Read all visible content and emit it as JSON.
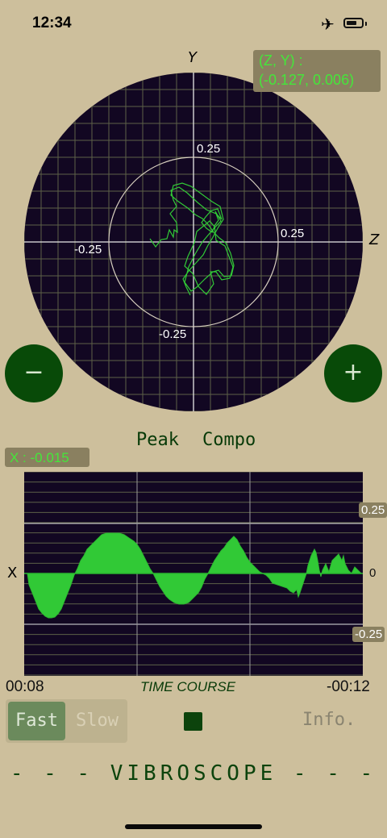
{
  "status_bar": {
    "time": "12:34",
    "airplane_icon": "airplane-icon",
    "battery_icon": "battery-icon"
  },
  "scope": {
    "y_axis_label": "Y",
    "z_axis_label": "Z",
    "ticks": {
      "top": "0.25",
      "right": "0.25",
      "left": "-0.25",
      "bottom": "-0.25"
    },
    "readout_line1": "(Z, Y) :",
    "readout_line2": "(-0.127, 0.006)",
    "zoom_out_label": "−",
    "zoom_in_label": "+"
  },
  "modes": {
    "peak": "Peak",
    "compo": "Compo"
  },
  "x_readout": "X : -0.015",
  "waveform": {
    "axis_label": "X",
    "y_ticks": {
      "top": "0.25",
      "middle": "0",
      "bottom": "-0.25"
    },
    "time_start": "00:08",
    "time_end": "-00:12",
    "title": "TIME COURSE"
  },
  "controls": {
    "fast": "Fast",
    "slow": "Slow",
    "info": "Info.",
    "stop_icon": "stop-icon"
  },
  "brand": "- - - VIBROSCOPE - - -",
  "colors": {
    "background": "#cdbf9c",
    "scope_bg": "#120722",
    "trace": "#31c936",
    "button": "#084a08"
  }
}
